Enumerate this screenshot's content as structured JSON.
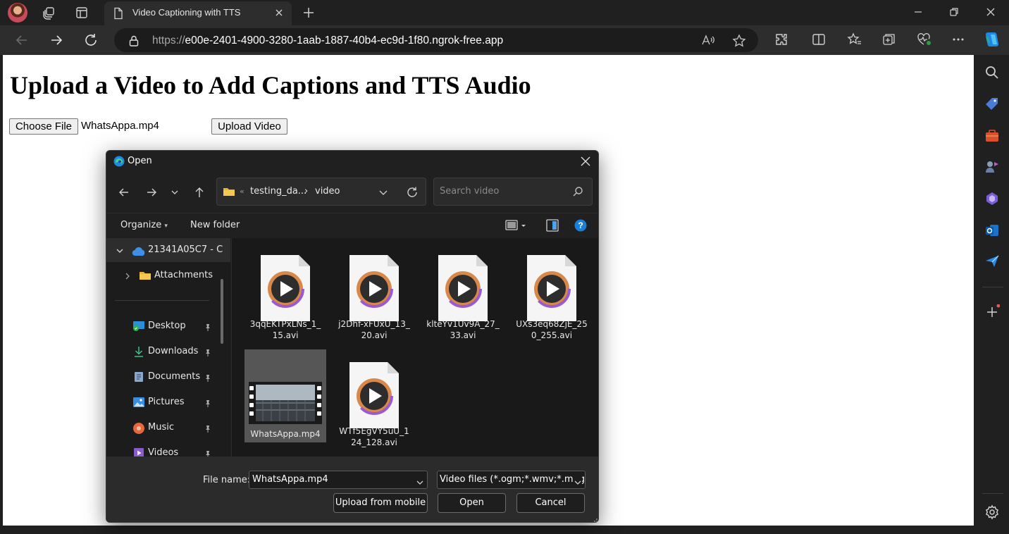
{
  "browser": {
    "tab_title": "Video Captioning with TTS",
    "url_protocol": "https://",
    "url_host": "e00e-2401-4900-3280-1aab-1887-40b4-ec9d-1f80.ngrok-free.app"
  },
  "page": {
    "heading": "Upload a Video to Add Captions and TTS Audio",
    "choose_file_label": "Choose File",
    "chosen_file": "WhatsAppa.mp4",
    "upload_button": "Upload Video"
  },
  "dialog": {
    "title": "Open",
    "path": {
      "crumb_sep_left": "«",
      "parent": "testing_da...",
      "sep": "›",
      "current": "video"
    },
    "search_placeholder": "Search video",
    "commands": {
      "organize": "Organize",
      "new_folder": "New folder"
    },
    "nav": {
      "onedrive": "21341A05C7 - C",
      "attachments": "Attachments",
      "desktop": "Desktop",
      "downloads": "Downloads",
      "documents": "Documents",
      "pictures": "Pictures",
      "music": "Music",
      "videos": "Videos"
    },
    "files": [
      {
        "name_line1": "3qqEKTPxLNs_1_",
        "name_line2": "15.avi"
      },
      {
        "name_line1": "j2Dhf-xFUxU_13_",
        "name_line2": "20.avi"
      },
      {
        "name_line1": "klteYv1Uv9A_27_",
        "name_line2": "33.avi"
      },
      {
        "name_line1": "UXs3eq68ZjE_25",
        "name_line2": "0_255.avi"
      },
      {
        "name_line1": "WhatsAppa.mp4",
        "name_line2": ""
      },
      {
        "name_line1": "WTf5EgVY5uU_1",
        "name_line2": "24_128.avi"
      }
    ],
    "footer": {
      "file_name_label": "File name:",
      "file_name_value": "WhatsAppa.mp4",
      "file_type": "Video files (*.ogm;*.wmv;*.mpg",
      "upload_mobile": "Upload from mobile",
      "open": "Open",
      "cancel": "Cancel"
    }
  },
  "colors": {
    "accent": "#0078d4",
    "chrome_dark": "#202020",
    "toolbar": "#2d2d2d"
  }
}
